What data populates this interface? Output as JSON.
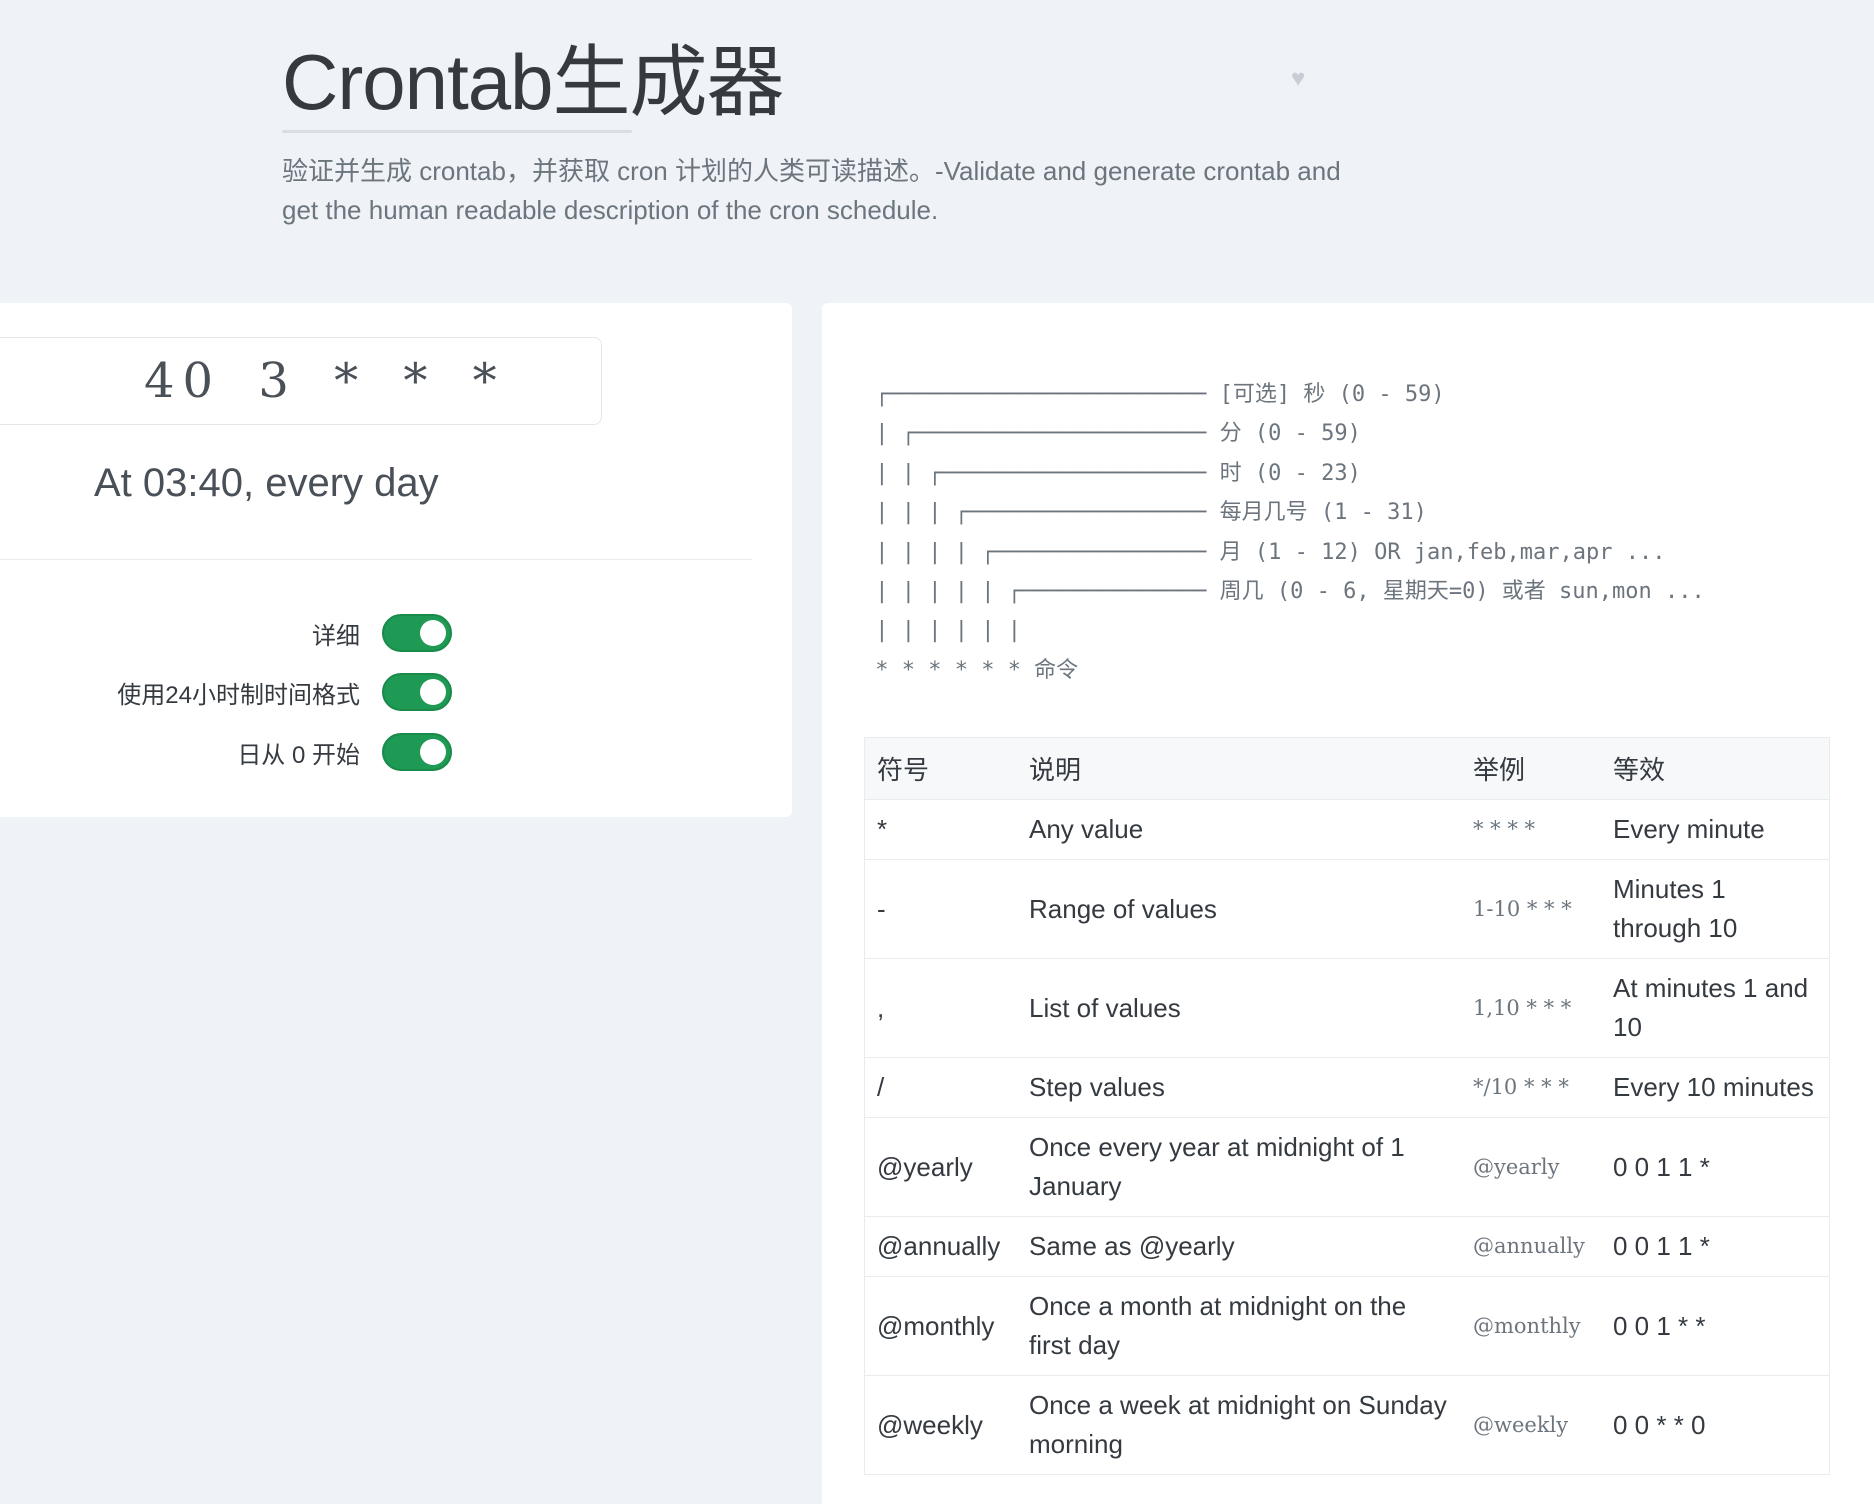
{
  "header": {
    "title": "Crontab生成器",
    "subtitle": "验证并生成 crontab，并获取 cron 计划的人类可读描述。-Validate and generate crontab and get the human readable description of the cron schedule."
  },
  "editor": {
    "expression": "40 3 * * *",
    "description": "At 03:40, every day"
  },
  "options": [
    {
      "label": "详细",
      "enabled": true
    },
    {
      "label": "使用24小时制时间格式",
      "enabled": true
    },
    {
      "label": "日从 0 开始",
      "enabled": true
    }
  ],
  "diagram": {
    "lines": [
      " ┌──────────────────────── [可选] 秒 (0 - 59)",
      " | ┌────────────────────── 分 (0 - 59)",
      " | | ┌──────────────────── 时 (0 - 23)",
      " | | | ┌────────────────── 每月几号 (1 - 31)",
      " | | | | ┌──────────────── 月 (1 - 12) OR jan,feb,mar,apr ...",
      " | | | | | ┌────────────── 周几 (0 - 6, 星期天=0) 或者 sun,mon ...",
      " | | | | | |",
      " * * * * * * 命令"
    ]
  },
  "table": {
    "headers": [
      "符号",
      "说明",
      "举例",
      "等效"
    ],
    "rows": [
      {
        "symbol": "*",
        "description": "Any value",
        "example": "* * * *",
        "equivalent": "Every minute"
      },
      {
        "symbol": "-",
        "description": "Range of values",
        "example": "1-10 * * *",
        "equivalent": "Minutes 1 through 10"
      },
      {
        "symbol": ",",
        "description": "List of values",
        "example": "1,10 * * *",
        "equivalent": "At minutes 1 and 10"
      },
      {
        "symbol": "/",
        "description": "Step values",
        "example": "*/10 * * *",
        "equivalent": "Every 10 minutes"
      },
      {
        "symbol": "@yearly",
        "description": "Once every year at midnight of 1 January",
        "example": "@yearly",
        "equivalent": "0 0 1 1 *"
      },
      {
        "symbol": "@annually",
        "description": "Same as @yearly",
        "example": "@annually",
        "equivalent": "0 0 1 1 *"
      },
      {
        "symbol": "@monthly",
        "description": "Once a month at midnight on the first day",
        "example": "@monthly",
        "equivalent": "0 0 1 * *"
      },
      {
        "symbol": "@weekly",
        "description": "Once a week at midnight on Sunday morning",
        "example": "@weekly",
        "equivalent": "0 0 * * 0"
      }
    ]
  },
  "colors": {
    "background": "#eff3f8",
    "toggle_on": "#1e9a54",
    "text": "#343a40",
    "muted": "#6c757d"
  }
}
